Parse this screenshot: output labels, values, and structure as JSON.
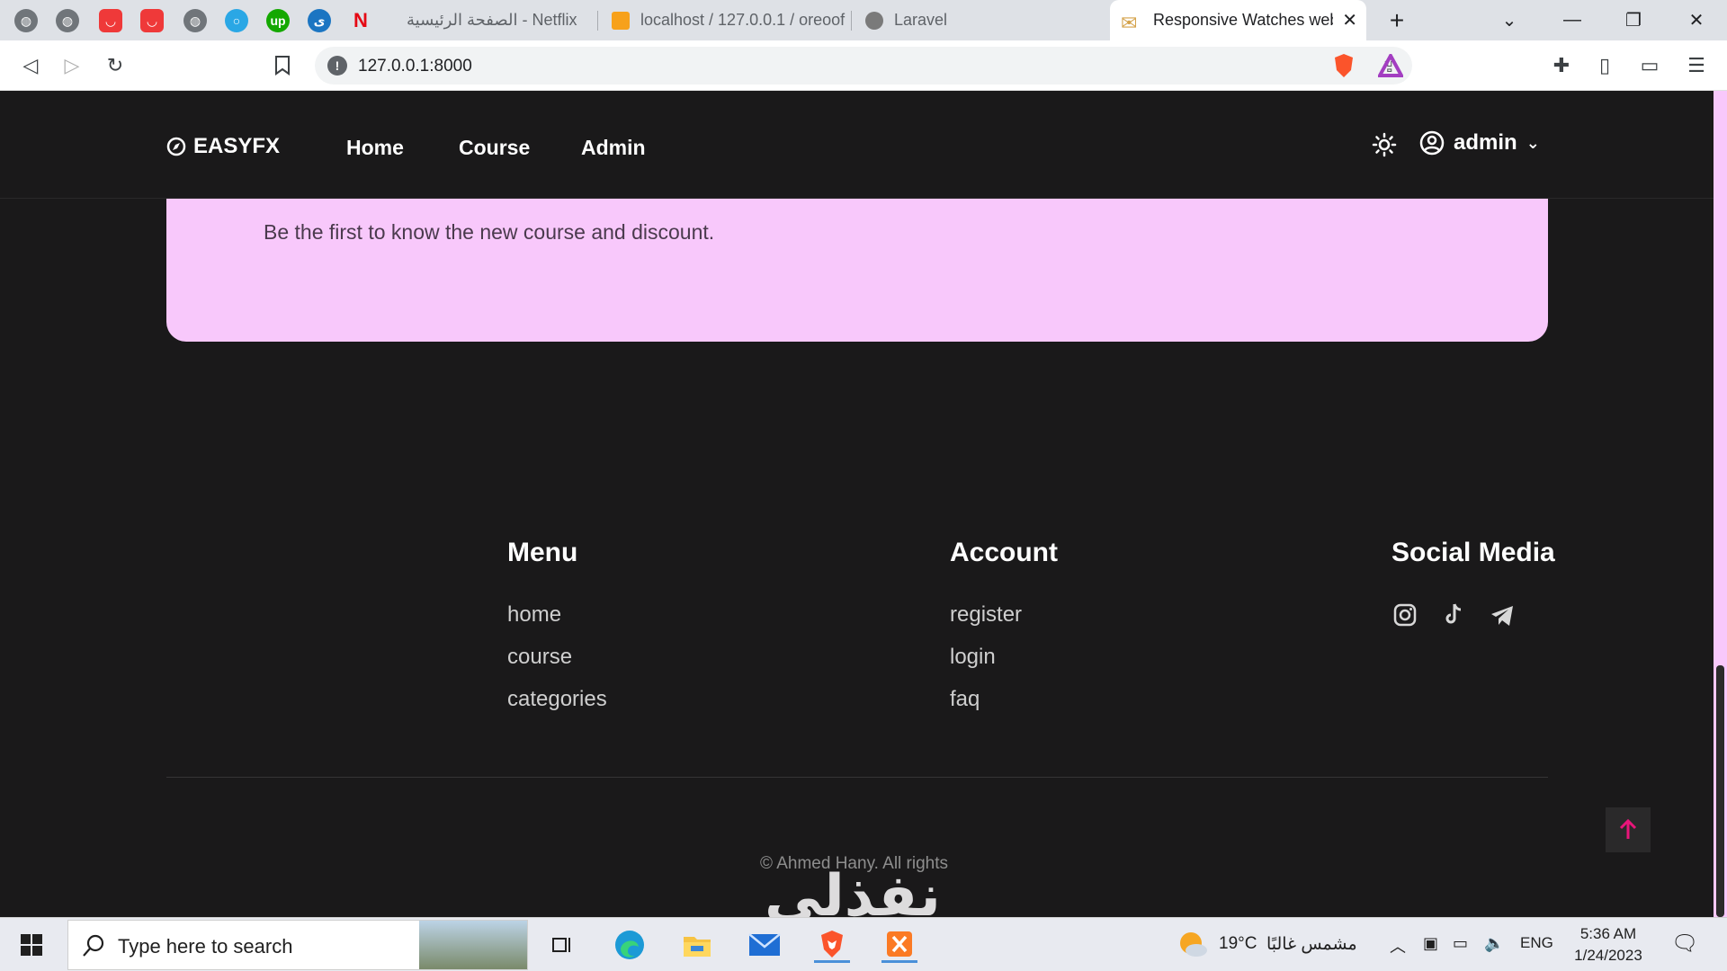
{
  "browser": {
    "tabs": [
      {
        "label": "Netflix - الصفحة الرئيسية"
      },
      {
        "label": "localhost / 127.0.0.1 / oreoof"
      },
      {
        "label": "Laravel"
      },
      {
        "label": "Responsive Watches web"
      }
    ],
    "url": "127.0.0.1:8000"
  },
  "site": {
    "logo": "EASYFX",
    "nav": [
      "Home",
      "Course",
      "Admin"
    ],
    "user": "admin",
    "newsletter_text": "Be the first to know the new course and discount.",
    "footer": {
      "menu_title": "Menu",
      "menu_links": [
        "home",
        "course",
        "categories"
      ],
      "account_title": "Account",
      "account_links": [
        "register",
        "login",
        "faq"
      ],
      "social_title": "Social Media",
      "social_icons": [
        "instagram-icon",
        "tiktok-icon",
        "telegram-icon"
      ]
    },
    "copyright": "© Ahmed Hany. All rights",
    "watermark": "نفذلي"
  },
  "taskbar": {
    "search_placeholder": "Type here to search",
    "weather": "19°C",
    "weather_desc": "مشمس غالبًا",
    "language": "ENG",
    "time": "5:36 AM",
    "date": "1/24/2023"
  },
  "colors": {
    "accent_pink": "#f8c8fb",
    "to_top_arrow": "#e8157a",
    "site_bg": "#1a191a"
  }
}
